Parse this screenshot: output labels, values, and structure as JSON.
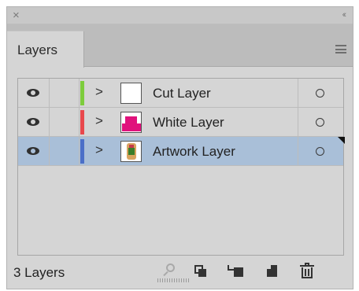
{
  "titlebar": {
    "close_icon": "close-icon",
    "collapse_glyph": "‹‹"
  },
  "panel": {
    "tab_label": "Layers",
    "menu_icon": "hamburger-menu-icon"
  },
  "layers": [
    {
      "name": "Cut Layer",
      "color": "#7dcc3c",
      "visible": true,
      "selected": false,
      "thumbnail": "blank-artboard"
    },
    {
      "name": "White Layer",
      "color": "#e8484c",
      "visible": true,
      "selected": false,
      "thumbnail": "pink-shapes"
    },
    {
      "name": "Artwork Layer",
      "color": "#4b6fc8",
      "visible": true,
      "selected": true,
      "thumbnail": "artwork-image"
    }
  ],
  "footer": {
    "layer_count": "3 Layers",
    "icons": [
      "locate-object-icon",
      "make-clipping-mask-icon",
      "create-sublayer-icon",
      "create-new-layer-icon",
      "delete-icon"
    ]
  },
  "colors": {
    "panel_bg": "#d5d5d5",
    "selection_bg": "#a9bfd8"
  }
}
